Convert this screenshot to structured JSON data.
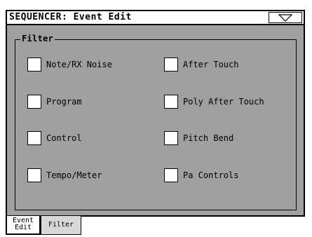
{
  "window": {
    "title": "SEQUENCER: Event Edit",
    "menu_icon": "triangle-down-icon"
  },
  "filter": {
    "title": "Filter",
    "items": [
      {
        "label": "Note/RX Noise",
        "checked": false
      },
      {
        "label": "After Touch",
        "checked": false
      },
      {
        "label": "Program",
        "checked": false
      },
      {
        "label": "Poly After Touch",
        "checked": false
      },
      {
        "label": "Control",
        "checked": false
      },
      {
        "label": "Pitch Bend",
        "checked": false
      },
      {
        "label": "Tempo/Meter",
        "checked": false
      },
      {
        "label": "Pa Controls",
        "checked": false
      }
    ]
  },
  "tabs": [
    {
      "label_line1": "Event",
      "label_line2": "Edit",
      "active": true
    },
    {
      "label_line1": "Filter",
      "label_line2": "",
      "active": false
    }
  ]
}
